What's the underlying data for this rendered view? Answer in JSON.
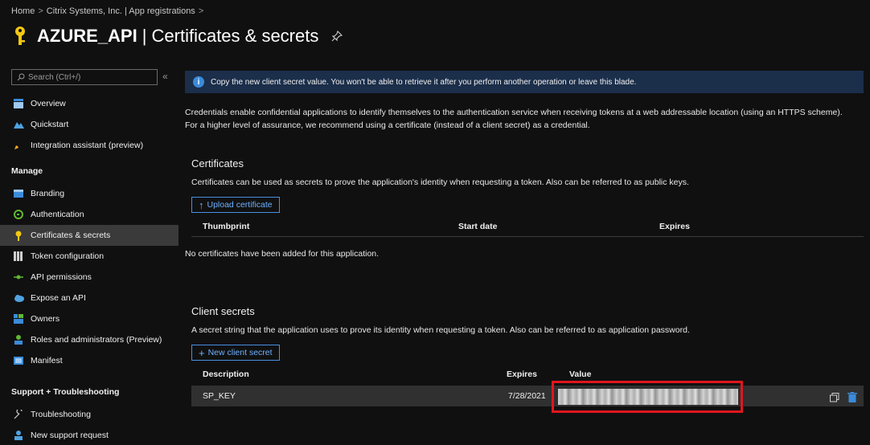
{
  "breadcrumb": [
    "Home",
    "Citrix Systems, Inc. | App registrations",
    ""
  ],
  "page": {
    "app_name": "AZURE_API",
    "title_rest": "| Certificates & secrets"
  },
  "sidebar": {
    "search_placeholder": "Search (Ctrl+/)",
    "collapse": "«",
    "top_items": [
      {
        "label": "Overview",
        "icon": "overview-icon"
      },
      {
        "label": "Quickstart",
        "icon": "quickstart-icon"
      },
      {
        "label": "Integration assistant (preview)",
        "icon": "rocket-icon"
      }
    ],
    "manage_header": "Manage",
    "manage_items": [
      {
        "label": "Branding",
        "icon": "branding-icon"
      },
      {
        "label": "Authentication",
        "icon": "authentication-icon"
      },
      {
        "label": "Certificates & secrets",
        "icon": "key-icon",
        "active": true
      },
      {
        "label": "Token configuration",
        "icon": "token-icon"
      },
      {
        "label": "API permissions",
        "icon": "api-permissions-icon"
      },
      {
        "label": "Expose an API",
        "icon": "cloud-icon"
      },
      {
        "label": "Owners",
        "icon": "owners-icon"
      },
      {
        "label": "Roles and administrators (Preview)",
        "icon": "roles-icon"
      },
      {
        "label": "Manifest",
        "icon": "manifest-icon"
      }
    ],
    "support_header": "Support + Troubleshooting",
    "support_items": [
      {
        "label": "Troubleshooting",
        "icon": "wrench-icon"
      },
      {
        "label": "New support request",
        "icon": "support-person-icon"
      }
    ]
  },
  "banner": {
    "text": "Copy the new client secret value. You won't be able to retrieve it after you perform another operation or leave this blade."
  },
  "intro": "Credentials enable confidential applications to identify themselves to the authentication service when receiving tokens at a web addressable location (using an HTTPS scheme). For a higher level of assurance, we recommend using a certificate (instead of a client secret) as a credential.",
  "certificates": {
    "title": "Certificates",
    "desc": "Certificates can be used as secrets to prove the application's identity when requesting a token. Also can be referred to as public keys.",
    "upload_label": "Upload certificate",
    "columns": [
      "Thumbprint",
      "Start date",
      "Expires"
    ],
    "empty_text": "No certificates have been added for this application."
  },
  "secrets": {
    "title": "Client secrets",
    "desc": "A secret string that the application uses to prove its identity when requesting a token. Also can be referred to as application password.",
    "new_label": "New client secret",
    "columns": [
      "Description",
      "Expires",
      "Value"
    ],
    "rows": [
      {
        "description": "SP_KEY",
        "expires": "7/28/2021"
      }
    ]
  },
  "colors": {
    "accent": "#4a8fe0",
    "active_bg": "#3a3a3a",
    "highlight": "#e0161f",
    "banner_bg": "#1b2e4a"
  }
}
